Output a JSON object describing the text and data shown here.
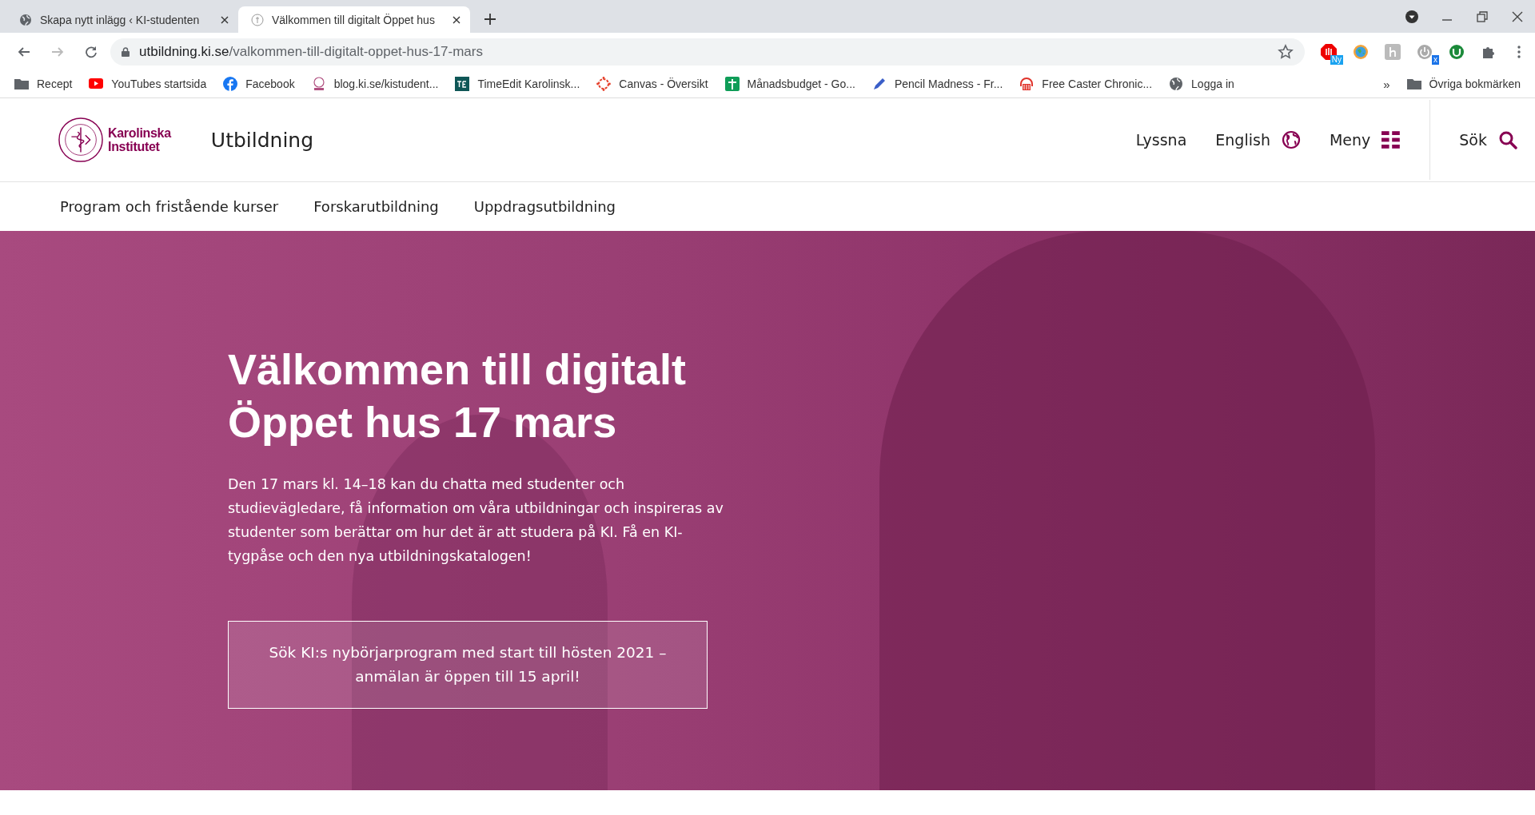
{
  "browser": {
    "tabs": [
      {
        "title": "Skapa nytt inlägg ‹ KI-studenten ",
        "selected": false
      },
      {
        "title": "Välkommen till digitalt Öppet hus",
        "selected": true
      }
    ],
    "url": {
      "host": "utbildning.ki.se",
      "path": "/valkommen-till-digitalt-oppet-hus-17-mars"
    },
    "extension_badges": [
      "Ny",
      "x"
    ],
    "bookmarks": [
      {
        "label": "Recept",
        "kind": "folder"
      },
      {
        "label": "YouTubes startsida",
        "kind": "youtube"
      },
      {
        "label": "Facebook",
        "kind": "facebook"
      },
      {
        "label": "blog.ki.se/kistudent...",
        "kind": "ki"
      },
      {
        "label": "TimeEdit Karolinsk...",
        "kind": "timeedit"
      },
      {
        "label": "Canvas - Översikt",
        "kind": "canvas"
      },
      {
        "label": "Månadsbudget - Go...",
        "kind": "sheets"
      },
      {
        "label": "Pencil Madness - Fr...",
        "kind": "pencil"
      },
      {
        "label": "Free Caster Chronic...",
        "kind": "headphones"
      },
      {
        "label": "Logga in",
        "kind": "globe"
      }
    ],
    "more": "»",
    "other_bookmarks": "Övriga bokmärken"
  },
  "site": {
    "logo": [
      "Karolinska",
      "Institutet"
    ],
    "section": "Utbildning",
    "actions": [
      {
        "label": "Lyssna",
        "kind": "text"
      },
      {
        "label": "English",
        "kind": "globe"
      },
      {
        "label": "Meny",
        "kind": "grid"
      },
      {
        "label": "Sök",
        "kind": "search"
      }
    ],
    "nav": [
      "Program och fristående kurser",
      "Forskarutbildning",
      "Uppdragsutbildning"
    ]
  },
  "hero": {
    "title": [
      "Välkommen till digitalt",
      "Öppet hus 17 mars"
    ],
    "text": "Den 17 mars kl. 14–18 kan du chatta med studenter och studievägledare, få information om våra utbildningar och inspireras av studenter som berättar om hur det är att studera på KI. Få en KI-tygpåse och den nya utbildningskatalogen!",
    "button": "Sök KI:s nybörjarprogram med start till hösten 2021 – anmälan är öppen till 15 april!"
  }
}
